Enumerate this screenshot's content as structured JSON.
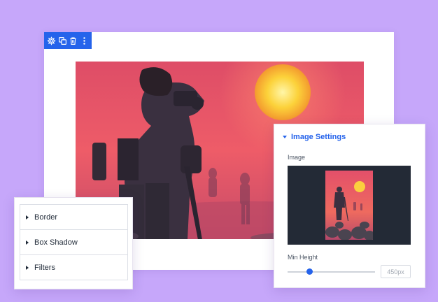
{
  "colors": {
    "background": "#c6a7fa",
    "accent": "#2563eb",
    "image_box_bg": "#232a36"
  },
  "toolbar": {
    "icons": [
      "gear-icon",
      "duplicate-icon",
      "trash-icon",
      "more-vertical-icon"
    ]
  },
  "photo": {
    "subject": "photographer-silhouette-at-sunset"
  },
  "style_panel": {
    "items": [
      {
        "label": "Border"
      },
      {
        "label": "Box Shadow"
      },
      {
        "label": "Filters"
      }
    ]
  },
  "image_settings": {
    "title": "Image Settings",
    "image_label": "Image",
    "min_height_label": "Min Height",
    "min_height_value": "450px",
    "min_height_slider_fraction": 0.25
  }
}
